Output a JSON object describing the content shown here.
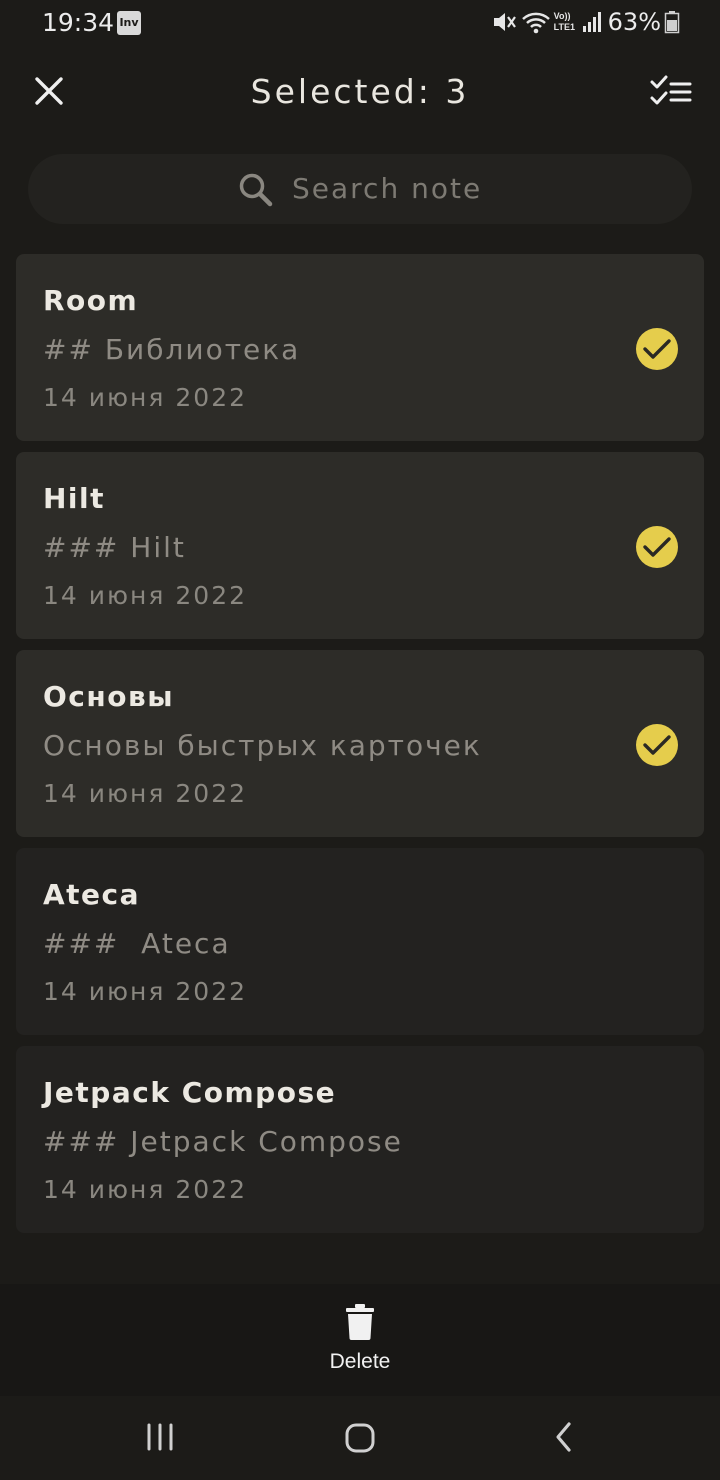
{
  "status_bar": {
    "time": "19:34",
    "app_icon_text": "Inv",
    "battery_percent": "63%",
    "icons": [
      "mute-icon",
      "wifi-icon",
      "volte-icon",
      "signal-icon",
      "battery-icon"
    ],
    "volte_top": "Vo))",
    "volte_bottom": "LTE1"
  },
  "header": {
    "title": "Selected: 3",
    "close_icon": "close-icon",
    "select_all_icon": "checklist-icon"
  },
  "search": {
    "placeholder": "Search note",
    "icon": "search-icon"
  },
  "notes": [
    {
      "title": "Room",
      "preview": "## Библиотека",
      "date": "14 июня 2022",
      "selected": true
    },
    {
      "title": "Hilt",
      "preview": "### Hilt",
      "date": "14 июня 2022",
      "selected": true
    },
    {
      "title": "Основы",
      "preview": "Основы быстрых карточек",
      "date": "14 июня 2022",
      "selected": true
    },
    {
      "title": "Ateca",
      "preview": "###  Ateca",
      "date": "14 июня 2022",
      "selected": false
    },
    {
      "title": "Jetpack Compose",
      "preview": "### Jetpack Compose",
      "date": "14 июня 2022",
      "selected": false
    }
  ],
  "action_bar": {
    "delete_label": "Delete",
    "delete_icon": "trash-icon"
  },
  "colors": {
    "background": "#1c1b18",
    "card_selected": "#2d2c28",
    "card_default": "#232220",
    "check_accent": "#e5cd4c"
  }
}
